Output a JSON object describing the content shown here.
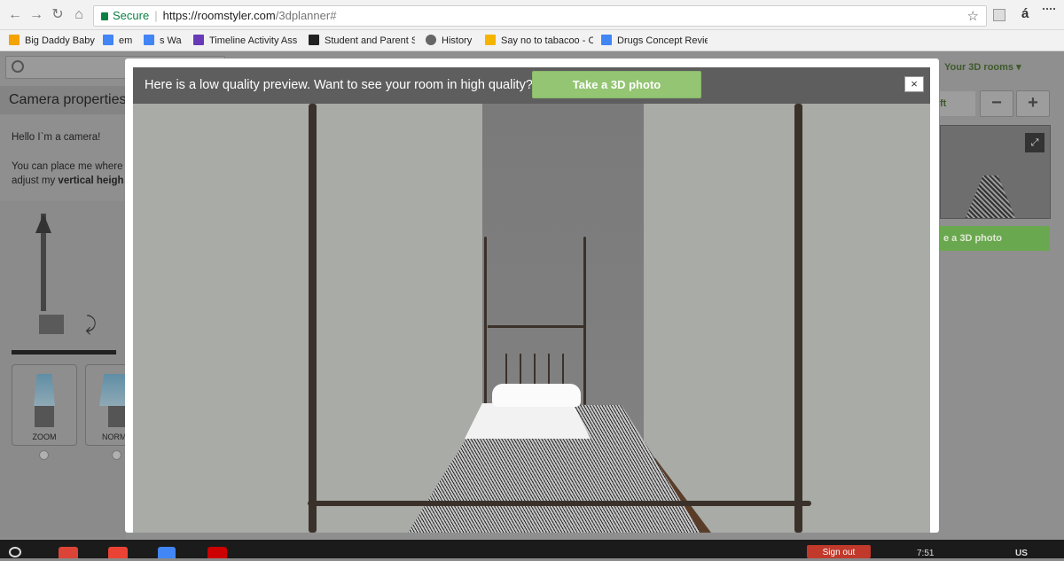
{
  "browser": {
    "secure_label": "Secure",
    "url_host": "https://roomstyler.com",
    "url_path": "/3dplanner#",
    "extension_glyph": "á"
  },
  "bookmarks": [
    {
      "label": "Big Daddy Baby",
      "color": "#f4a300"
    },
    {
      "label": "em",
      "color": "#4285f4"
    },
    {
      "label": "s Wa",
      "color": "#4285f4"
    },
    {
      "label": "Timeline Activity Ass",
      "color": "#673ab7"
    },
    {
      "label": "Student and Parent S",
      "color": "#222222"
    },
    {
      "label": "History",
      "color": "#666666"
    },
    {
      "label": "Say no to tabacoo - C",
      "color": "#f4b400"
    },
    {
      "label": "Drugs Concept Revie",
      "color": "#4285f4"
    }
  ],
  "app": {
    "left_panel_title": "Camera properties",
    "left_greeting": "Hello I`m a camera!",
    "left_body_prefix": "You can place me where",
    "left_body_adjust": "adjust my",
    "left_body_bold": "vertical heigh",
    "modes": [
      {
        "label": "ZOOM"
      },
      {
        "label": "NORM"
      }
    ],
    "rooms_label": "Your 3D rooms ▾",
    "zoom_minus": "−",
    "zoom_plus": "+",
    "left_stub": "ft",
    "expand_icon": "⤢",
    "right_photo_label": "e a 3D photo"
  },
  "modal": {
    "message": "Here is a low quality preview. Want to see your room in high quality?",
    "cta": "Take a 3D photo",
    "close": "×"
  },
  "taskbar": {
    "signout": "Sign out",
    "time": "7:51",
    "locale": "US"
  }
}
